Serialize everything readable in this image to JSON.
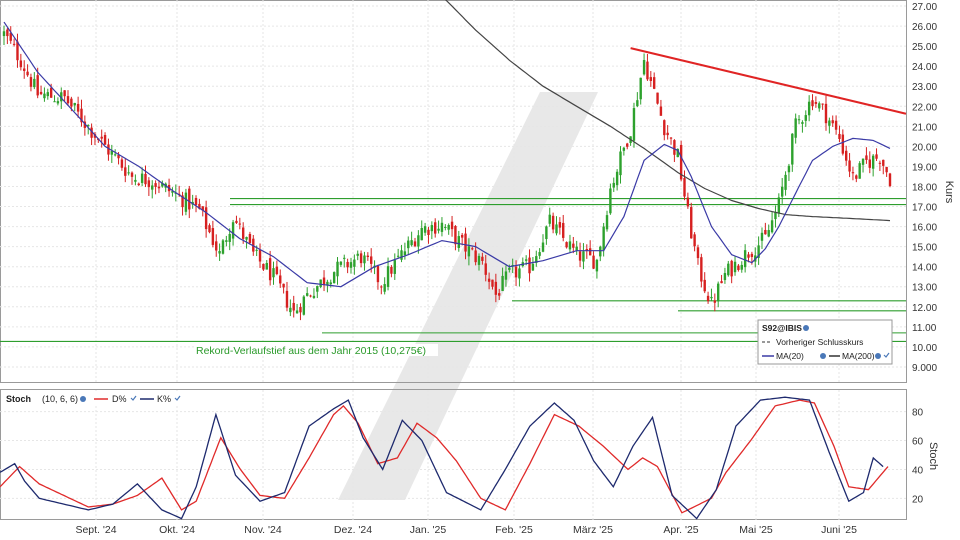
{
  "chart_data": [
    {
      "type": "candlestick",
      "symbol": "S92@IBIS",
      "ylabel": "Kurs",
      "ylim": [
        8.2,
        27.3
      ],
      "y_ticks": [
        "9.000",
        "10.00",
        "11.00",
        "12.00",
        "13.00",
        "14.00",
        "15.00",
        "16.00",
        "17.00",
        "18.00",
        "19.00",
        "20.00",
        "21.00",
        "22.00",
        "23.00",
        "24.00",
        "25.00",
        "26.00",
        "27.00"
      ],
      "x_ticks": [
        "Sept. '24",
        "Okt. '24",
        "Nov. '24",
        "Dez. '24",
        "Jan. '25",
        "Feb. '25",
        "März '25",
        "Apr. '25",
        "Mai '25",
        "Juni '25"
      ],
      "price_anchors": [
        [
          0,
          25.6
        ],
        [
          5,
          24.3
        ],
        [
          10,
          22.6
        ],
        [
          18,
          22.4
        ],
        [
          25,
          21.0
        ],
        [
          30,
          20.0
        ],
        [
          38,
          18.5
        ],
        [
          44,
          18.3
        ],
        [
          48,
          17.9
        ],
        [
          52,
          17.5
        ],
        [
          58,
          16.8
        ],
        [
          64,
          14.6
        ],
        [
          68,
          16.5
        ],
        [
          74,
          14.6
        ],
        [
          80,
          13.5
        ],
        [
          86,
          11.7
        ],
        [
          90,
          12.6
        ],
        [
          98,
          13.8
        ],
        [
          106,
          14.5
        ],
        [
          112,
          13.2
        ],
        [
          118,
          14.6
        ],
        [
          124,
          15.9
        ],
        [
          130,
          16.1
        ],
        [
          136,
          15.1
        ],
        [
          142,
          14.2
        ],
        [
          146,
          12.6
        ],
        [
          150,
          13.6
        ],
        [
          156,
          14.0
        ],
        [
          162,
          16.2
        ],
        [
          170,
          14.6
        ],
        [
          176,
          14.3
        ],
        [
          180,
          17.9
        ],
        [
          186,
          20.9
        ],
        [
          190,
          24.3
        ],
        [
          196,
          21.0
        ],
        [
          200,
          19.5
        ],
        [
          203,
          16.6
        ],
        [
          206,
          14.0
        ],
        [
          210,
          12.1
        ],
        [
          214,
          13.6
        ],
        [
          220,
          14.6
        ],
        [
          226,
          15.4
        ],
        [
          230,
          17.1
        ],
        [
          235,
          21.0
        ],
        [
          240,
          22.4
        ],
        [
          244,
          21.6
        ],
        [
          248,
          20.4
        ],
        [
          252,
          18.4
        ],
        [
          256,
          19.2
        ],
        [
          260,
          19.5
        ],
        [
          263,
          18.4
        ]
      ],
      "ma20_anchors": [
        [
          0,
          26.2
        ],
        [
          10,
          23.7
        ],
        [
          22,
          21.5
        ],
        [
          30,
          20.0
        ],
        [
          40,
          19.0
        ],
        [
          50,
          17.8
        ],
        [
          60,
          16.7
        ],
        [
          70,
          15.4
        ],
        [
          80,
          14.5
        ],
        [
          90,
          13.2
        ],
        [
          100,
          13.0
        ],
        [
          110,
          14.0
        ],
        [
          120,
          14.6
        ],
        [
          130,
          15.3
        ],
        [
          140,
          15.0
        ],
        [
          150,
          14.0
        ],
        [
          160,
          14.3
        ],
        [
          170,
          14.8
        ],
        [
          178,
          14.8
        ],
        [
          184,
          16.5
        ],
        [
          190,
          19.3
        ],
        [
          196,
          20.1
        ],
        [
          200,
          19.8
        ],
        [
          204,
          18.5
        ],
        [
          210,
          16.0
        ],
        [
          216,
          14.6
        ],
        [
          222,
          14.2
        ],
        [
          226,
          14.9
        ],
        [
          230,
          16.0
        ],
        [
          236,
          18.0
        ],
        [
          240,
          19.3
        ],
        [
          246,
          20.0
        ],
        [
          252,
          20.4
        ],
        [
          258,
          20.3
        ],
        [
          263,
          19.9
        ]
      ],
      "ma200_anchors": [
        [
          130,
          27.5
        ],
        [
          140,
          25.8
        ],
        [
          150,
          24.3
        ],
        [
          160,
          23.0
        ],
        [
          170,
          22.0
        ],
        [
          180,
          21.0
        ],
        [
          190,
          19.9
        ],
        [
          200,
          18.7
        ],
        [
          208,
          17.9
        ],
        [
          216,
          17.3
        ],
        [
          224,
          16.9
        ],
        [
          232,
          16.6
        ],
        [
          240,
          16.5
        ],
        [
          252,
          16.4
        ],
        [
          263,
          16.3
        ]
      ],
      "trendline": {
        "from": [
          186,
          24.9
        ],
        "to": [
          263,
          21.9
        ],
        "extend_to": 270
      },
      "support_levels": [
        17.4,
        17.1,
        12.3,
        11.8,
        10.7,
        10.275
      ],
      "annotation": "Rekord-Verlaufstief aus dem Jahr 2015 (10,275€)",
      "legend": {
        "symbol": "S92@IBIS",
        "items": [
          "Vorheriger Schlusskurs",
          "MA(20)",
          "MA(200)"
        ]
      }
    },
    {
      "type": "line",
      "title": "Stoch",
      "params": "(10, 6, 6)",
      "ylabel": "Stoch",
      "ylim": [
        5,
        95
      ],
      "y_ticks": [
        "20",
        "40",
        "60",
        "80"
      ],
      "series": [
        {
          "name": "D%",
          "color": "#e02a2a",
          "anchors": [
            [
              0,
              28
            ],
            [
              8,
              42
            ],
            [
              16,
              30
            ],
            [
              26,
              22
            ],
            [
              36,
              14
            ],
            [
              46,
              16
            ],
            [
              56,
              22
            ],
            [
              66,
              34
            ],
            [
              74,
              12
            ],
            [
              80,
              18
            ],
            [
              90,
              62
            ],
            [
              98,
              40
            ],
            [
              106,
              22
            ],
            [
              116,
              20
            ],
            [
              126,
              48
            ],
            [
              136,
              78
            ],
            [
              140,
              84
            ],
            [
              146,
              72
            ],
            [
              154,
              44
            ],
            [
              162,
              48
            ],
            [
              170,
              72
            ],
            [
              178,
              62
            ],
            [
              186,
              46
            ],
            [
              196,
              20
            ],
            [
              206,
              12
            ],
            [
              216,
              44
            ],
            [
              226,
              78
            ],
            [
              236,
              70
            ],
            [
              246,
              56
            ],
            [
              256,
              40
            ],
            [
              262,
              48
            ],
            [
              268,
              42
            ],
            [
              278,
              10
            ],
            [
              290,
              20
            ],
            [
              296,
              38
            ],
            [
              306,
              60
            ],
            [
              316,
              84
            ],
            [
              326,
              88
            ],
            [
              332,
              86
            ],
            [
              340,
              56
            ],
            [
              346,
              28
            ],
            [
              354,
              26
            ],
            [
              362,
              42
            ]
          ]
        },
        {
          "name": "K%",
          "color": "#1e2a6e",
          "anchors": [
            [
              0,
              38
            ],
            [
              6,
              44
            ],
            [
              10,
              32
            ],
            [
              16,
              20
            ],
            [
              26,
              16
            ],
            [
              36,
              12
            ],
            [
              46,
              16
            ],
            [
              56,
              30
            ],
            [
              66,
              12
            ],
            [
              74,
              6
            ],
            [
              80,
              28
            ],
            [
              88,
              78
            ],
            [
              96,
              36
            ],
            [
              106,
              18
            ],
            [
              116,
              24
            ],
            [
              126,
              70
            ],
            [
              136,
              82
            ],
            [
              142,
              88
            ],
            [
              148,
              62
            ],
            [
              156,
              40
            ],
            [
              164,
              74
            ],
            [
              172,
              60
            ],
            [
              182,
              24
            ],
            [
              196,
              12
            ],
            [
              206,
              40
            ],
            [
              216,
              70
            ],
            [
              226,
              86
            ],
            [
              234,
              74
            ],
            [
              242,
              46
            ],
            [
              250,
              28
            ],
            [
              258,
              56
            ],
            [
              266,
              76
            ],
            [
              274,
              22
            ],
            [
              284,
              6
            ],
            [
              292,
              26
            ],
            [
              300,
              70
            ],
            [
              310,
              88
            ],
            [
              320,
              90
            ],
            [
              330,
              88
            ],
            [
              338,
              52
            ],
            [
              346,
              18
            ],
            [
              352,
              24
            ],
            [
              356,
              48
            ],
            [
              360,
              42
            ]
          ]
        }
      ]
    }
  ]
}
